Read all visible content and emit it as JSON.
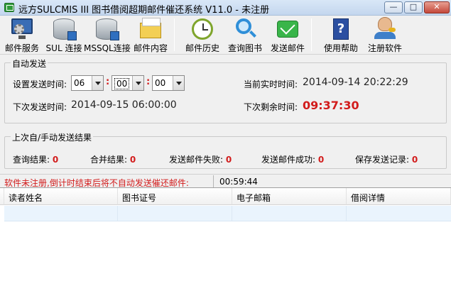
{
  "window": {
    "title": "远方SULCMIS III 图书借阅超期邮件催还系统 V11.0 - 未注册",
    "min_glyph": "—",
    "max_glyph": "□",
    "close_glyph": "✕"
  },
  "toolbar": {
    "mail_service": "邮件服务",
    "sul_connect": "SUL 连接",
    "mssql_connect": "MSSQL连接",
    "mail_content": "邮件内容",
    "mail_history": "邮件历史",
    "query_books": "查询图书",
    "send_mail": "发送邮件",
    "help": "使用帮助",
    "help_glyph": "?",
    "register": "注册软件"
  },
  "auto_send": {
    "title": "自动发送",
    "set_time_label": "设置发送时间:",
    "hour": "06",
    "minute": "00",
    "second": "00",
    "separator": ":",
    "current_time_label": "当前实时时间:",
    "current_time": "2014-09-14 20:22:29",
    "next_send_label": "下次发送时间:",
    "next_send": "2014-09-15 06:00:00",
    "remaining_label": "下次剩余时间:",
    "remaining": "09:37:30"
  },
  "results": {
    "title": "上次自/手动发送结果",
    "query_label": "查询结果:",
    "query_count": "0",
    "merge_label": "合并结果:",
    "merge_count": "0",
    "fail_label": "发送邮件失败:",
    "fail_count": "0",
    "success_label": "发送邮件成功:",
    "success_count": "0",
    "saved_label": "保存发送记录:",
    "saved_count": "0"
  },
  "status": {
    "message": "软件未注册,倒计时结束后将不自动发送催还邮件:",
    "countdown": "00:59:44"
  },
  "grid": {
    "columns": [
      "读者姓名",
      "图书证号",
      "电子邮箱",
      "借阅详情"
    ]
  }
}
